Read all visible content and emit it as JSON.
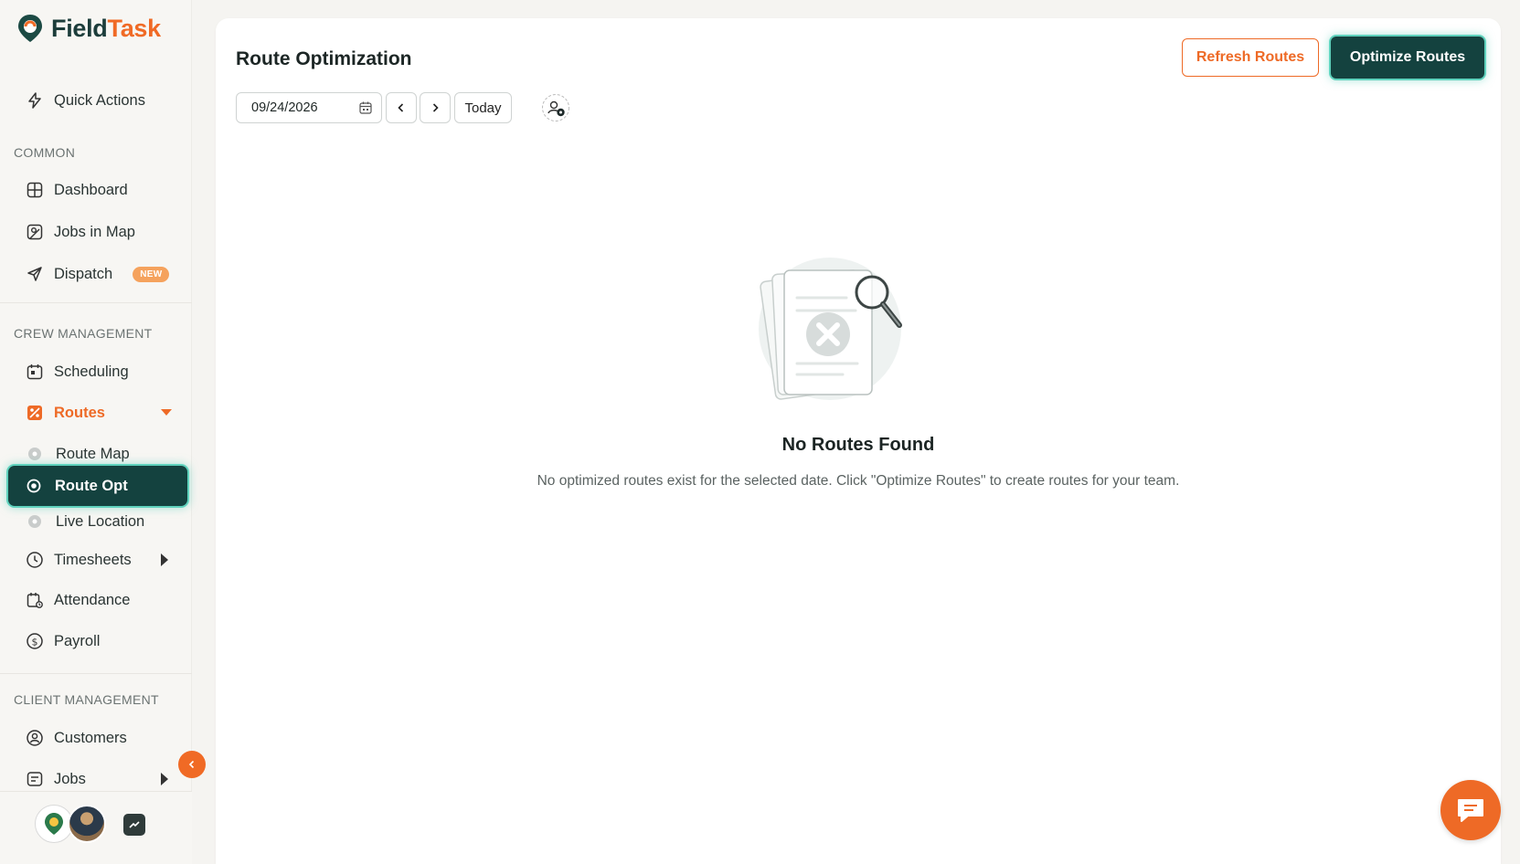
{
  "brand": {
    "name_part1": "Field",
    "name_part2": "Task",
    "primary_color": "#14423f",
    "accent_color": "#ee6a26"
  },
  "sidebar": {
    "quick_actions": "Quick Actions",
    "sections": {
      "common": "COMMON",
      "crew": "CREW MANAGEMENT",
      "client": "CLIENT MANAGEMENT"
    },
    "common_items": [
      {
        "label": "Dashboard",
        "icon": "dashboard-icon"
      },
      {
        "label": "Jobs in Map",
        "icon": "map-icon"
      },
      {
        "label": "Dispatch",
        "icon": "send-icon",
        "badge": "NEW"
      }
    ],
    "crew_items": [
      {
        "label": "Scheduling",
        "icon": "calendar-icon"
      },
      {
        "label": "Routes",
        "icon": "route-icon",
        "expanded": true
      },
      {
        "label": "Route Map",
        "icon": "dot-icon"
      },
      {
        "label": "Route Opt",
        "icon": "target-icon",
        "selected": true
      },
      {
        "label": "Live Location",
        "icon": "dot-icon"
      },
      {
        "label": "Timesheets",
        "icon": "clock-icon"
      },
      {
        "label": "Attendance",
        "icon": "attendance-icon"
      },
      {
        "label": "Payroll",
        "icon": "payroll-icon"
      }
    ],
    "client_items": [
      {
        "label": "Customers",
        "icon": "customer-icon"
      },
      {
        "label": "Jobs",
        "icon": "jobs-icon"
      }
    ]
  },
  "main": {
    "title": "Route Optimization",
    "refresh_label": "Refresh Routes",
    "optimize_label": "Optimize Routes",
    "date_value": "09/24/2026",
    "today_label": "Today",
    "empty_title": "No Routes Found",
    "empty_description": "No optimized routes exist for the selected date. Click \"Optimize Routes\" to create routes for your team."
  }
}
